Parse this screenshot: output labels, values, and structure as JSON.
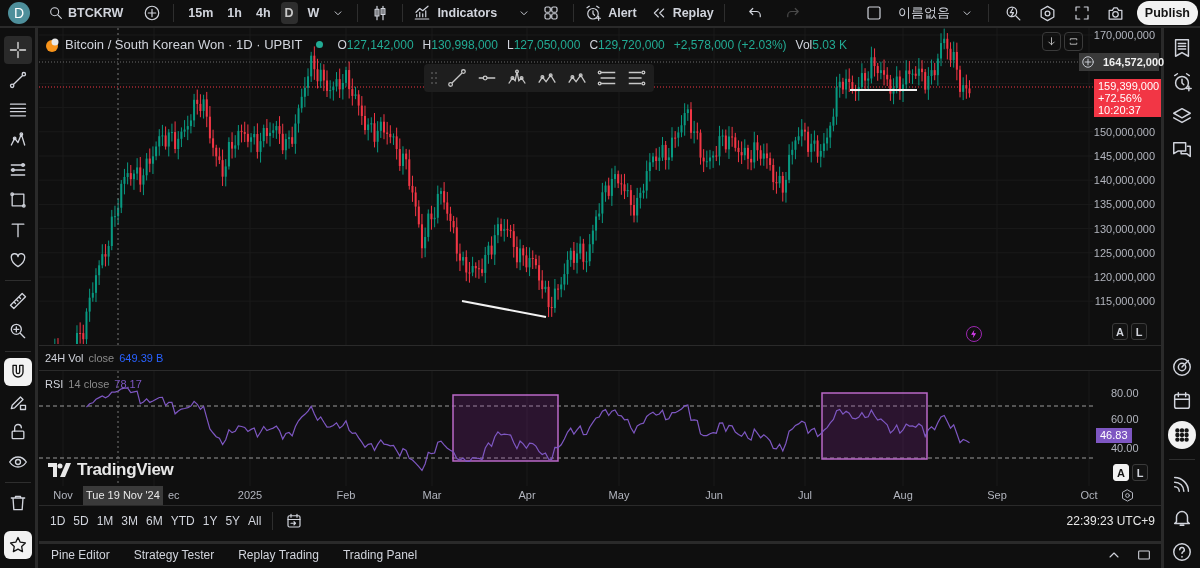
{
  "header": {
    "avatar": "D",
    "symbol": "BTCKRW",
    "intervals": [
      {
        "label": "15m",
        "selected": false
      },
      {
        "label": "1h",
        "selected": false
      },
      {
        "label": "4h",
        "selected": false
      },
      {
        "label": "D",
        "selected": true
      },
      {
        "label": "W",
        "selected": false
      }
    ],
    "indicators": "Indicators",
    "alert": "Alert",
    "replay": "Replay",
    "history": [
      {
        "disabled": false
      },
      {
        "disabled": true
      }
    ],
    "layout_name": "이름없음",
    "publish": "Publish"
  },
  "left_toolbar": {
    "tools": [
      {
        "selected": true
      },
      {
        "selected": false
      },
      {
        "selected": false
      },
      {
        "selected": false
      },
      {
        "selected": false
      },
      {
        "selected": false
      },
      {
        "selected": false
      },
      {
        "selected": false
      },
      {
        "selected": false
      },
      {
        "selected": false
      }
    ],
    "toggles": [
      {
        "on": true
      },
      {
        "on": false
      },
      {
        "on": false
      },
      {
        "on": false
      }
    ],
    "favorites": {
      "on": true
    }
  },
  "legend": {
    "title": "Bitcoin / South Korean Won · 1D · UPBIT",
    "ohlc": [
      {
        "key": "O",
        "value": "127,142,000"
      },
      {
        "key": "H",
        "value": "130,998,000"
      },
      {
        "key": "L",
        "value": "127,050,000"
      },
      {
        "key": "C",
        "value": "129,720,000"
      }
    ],
    "change": "+2,578,000 (+2.03%)",
    "vol_key": "Vol",
    "vol_value": "5.03 K"
  },
  "price_axis": {
    "ticks": [
      "170,000,000",
      "150,000,000",
      "145,000,000",
      "140,000,000",
      "135,000,000",
      "130,000,000",
      "125,000,000",
      "120,000,000",
      "115,000,000"
    ],
    "crosshair_price": "164,572,000",
    "last_price": "159,399,000",
    "last_change": "+72.56%",
    "countdown": "10:20:37"
  },
  "main_scale": [
    {
      "label": "A",
      "selected": false
    },
    {
      "label": "L",
      "selected": false
    }
  ],
  "volume": {
    "name": "24H Vol",
    "params": "close",
    "value": "649.39 B"
  },
  "rsi": {
    "name": "RSI",
    "params": "14 close",
    "value": "78.17",
    "ticks": [
      "80.00",
      "60.00",
      "40.00"
    ],
    "last": "46.83",
    "scale": [
      {
        "label": "A",
        "selected": true
      },
      {
        "label": "L",
        "selected": false
      }
    ]
  },
  "logo": "TradingView",
  "time_axis": {
    "labels": [
      "Nov",
      "ec",
      "2025",
      "Feb",
      "Mar",
      "Apr",
      "May",
      "Jun",
      "Jul",
      "Aug",
      "Sep",
      "Oct"
    ],
    "crosshair_date": "Tue 19 Nov '24"
  },
  "ranges": [
    {
      "label": "1D",
      "selected": false
    },
    {
      "label": "5D",
      "selected": false
    },
    {
      "label": "1M",
      "selected": false
    },
    {
      "label": "3M",
      "selected": false
    },
    {
      "label": "6M",
      "selected": false
    },
    {
      "label": "YTD",
      "selected": false
    },
    {
      "label": "1Y",
      "selected": false
    },
    {
      "label": "5Y",
      "selected": false
    },
    {
      "label": "All",
      "selected": false
    }
  ],
  "clock": "22:39:23 UTC+9",
  "bottom_tabs": [
    "Pine Editor",
    "Strategy Tester",
    "Replay Trading",
    "Trading Panel"
  ],
  "right_toolbar": [
    {
      "selected": false
    },
    {
      "selected": false
    },
    {
      "selected": false
    },
    {
      "selected": false
    },
    {
      "selected": false
    },
    {
      "selected": false
    },
    {
      "selected": true
    },
    {
      "selected": false
    },
    {
      "selected": false
    },
    {
      "selected": false
    }
  ]
}
